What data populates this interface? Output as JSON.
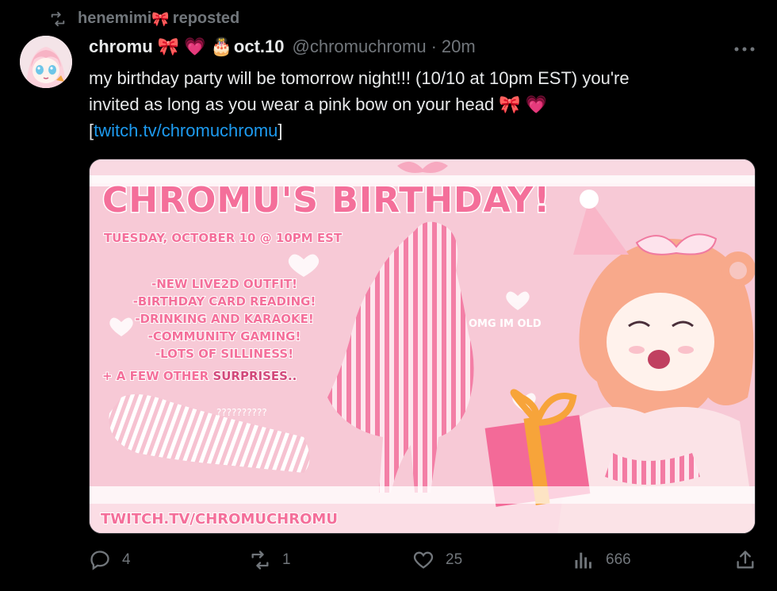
{
  "repost": {
    "user": "henemimi",
    "bow": "🎀",
    "label": "reposted"
  },
  "author": {
    "name": "chromu",
    "badges": [
      "🎀",
      "💗",
      "🎂"
    ],
    "date_tag": "oct.10",
    "handle": "@chromuchromu",
    "separator": "·",
    "time": "20m"
  },
  "tweet": {
    "line1": "my birthday party will be tomorrow night!!! (10/10 at 10pm EST) you're",
    "line2": "invited as long as you wear a pink bow on your head",
    "line2_emojis": "🎀 💗",
    "link_open": "[",
    "link": "twitch.tv/chromuchromu",
    "link_close": "]"
  },
  "card": {
    "title": "CHROMU'S BIRTHDAY!",
    "date": "TUESDAY, OCTOBER 10 @ 10PM EST",
    "items": [
      "-NEW LIVE2D OUTFIT!",
      "-BIRTHDAY CARD READING!",
      "-DRINKING AND KARAOKE!",
      "-COMMUNITY GAMING!",
      "-LOTS OF SILLINESS!"
    ],
    "extra_prefix": "+ A FEW OTHER",
    "extra_word": "SURPRISES..",
    "side_note": "OMG IM OLD",
    "mystery": "??????????",
    "footer": "TWITCH.TV/CHROMUCHROMU"
  },
  "actions": {
    "replies": "4",
    "reposts": "1",
    "likes": "25",
    "views": "666"
  },
  "colors": {
    "background": "#000000",
    "text": "#e7e9ea",
    "muted": "#71767b",
    "link": "#1d9bf0",
    "card_pink": "#f7c9d6",
    "card_hot_pink": "#f07aa0"
  }
}
